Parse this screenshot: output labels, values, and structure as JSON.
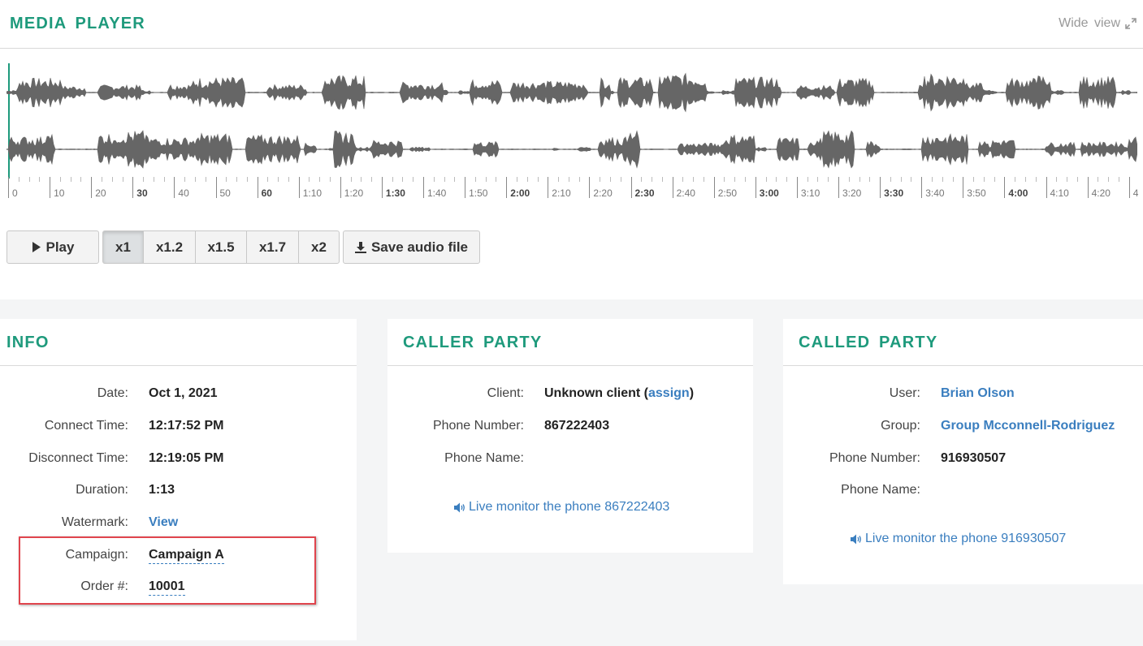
{
  "media_player": {
    "title": "MEDIA PLAYER",
    "wide_view_label": "Wide view",
    "timeline_labels": [
      "0",
      "10",
      "20",
      "30",
      "40",
      "50",
      "60",
      "1:10",
      "1:20",
      "1:30",
      "1:40",
      "1:50",
      "2:00",
      "2:10",
      "2:20",
      "2:30",
      "2:40",
      "2:50",
      "3:00",
      "3:10",
      "3:20",
      "3:30",
      "3:40",
      "3:50",
      "4:00",
      "4:10",
      "4:20",
      "4"
    ],
    "play_label": "Play",
    "speeds": [
      "x1",
      "x1.2",
      "x1.5",
      "x1.7",
      "x2"
    ],
    "active_speed": "x1",
    "save_label": "Save audio file"
  },
  "info": {
    "title": "INFO",
    "date_label": "Date:",
    "date_value": "Oct 1, 2021",
    "connect_label": "Connect Time:",
    "connect_value": "12:17:52 PM",
    "disconnect_label": "Disconnect Time:",
    "disconnect_value": "12:19:05 PM",
    "duration_label": "Duration:",
    "duration_value": "1:13",
    "watermark_label": "Watermark:",
    "watermark_value": "View",
    "campaign_label": "Campaign:",
    "campaign_value": "Campaign A",
    "order_label": "Order #:",
    "order_value": "10001"
  },
  "caller": {
    "title": "CALLER PARTY",
    "client_label": "Client:",
    "client_value": "Unknown client (",
    "client_assign": "assign",
    "client_close": ")",
    "phone_number_label": "Phone Number:",
    "phone_number_value": "867222403",
    "phone_name_label": "Phone Name:",
    "monitor_label": "Live monitor the phone 867222403"
  },
  "called": {
    "title": "CALLED PARTY",
    "user_label": "User:",
    "user_value": "Brian Olson",
    "group_label": "Group:",
    "group_value": "Group Mcconnell-Rodriguez",
    "phone_number_label": "Phone Number:",
    "phone_number_value": "916930507",
    "phone_name_label": "Phone Name:",
    "monitor_label": "Live monitor the phone 916930507"
  },
  "colors": {
    "accent": "#1e9a7c",
    "link": "#3a7ebf",
    "highlight": "#e0454d",
    "wave": "#666666",
    "cursor": "#1e9a7c"
  }
}
